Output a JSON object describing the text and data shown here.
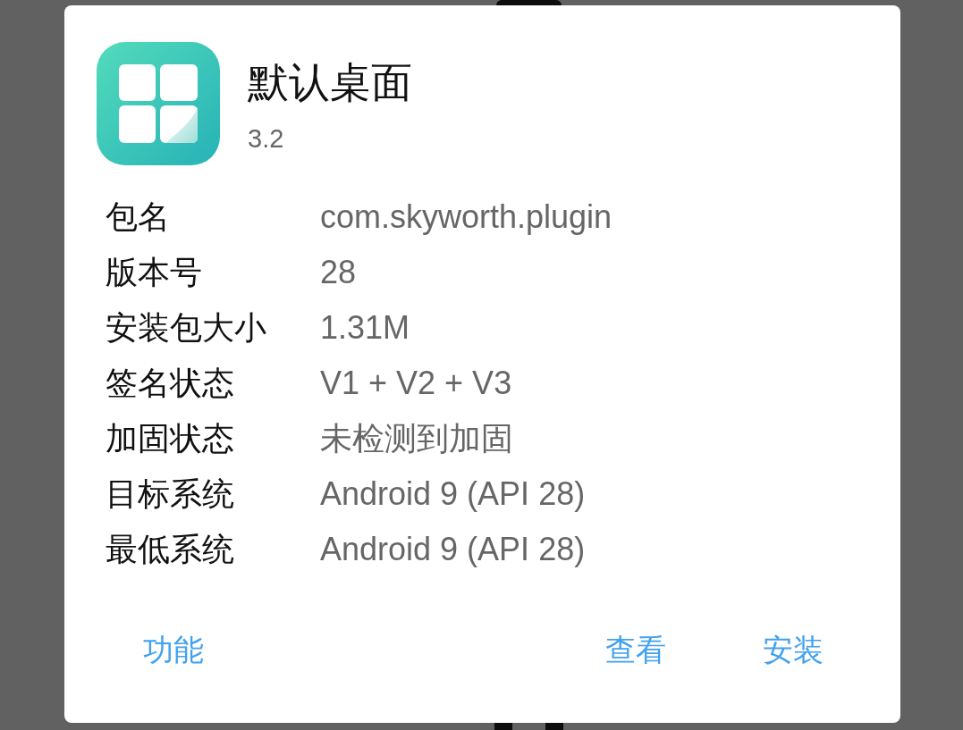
{
  "app": {
    "name": "默认桌面",
    "version": "3.2"
  },
  "details": [
    {
      "label": "包名",
      "value": "com.skyworth.plugin"
    },
    {
      "label": "版本号",
      "value": "28"
    },
    {
      "label": "安装包大小",
      "value": "1.31M"
    },
    {
      "label": "签名状态",
      "value": "V1 + V2 + V3"
    },
    {
      "label": "加固状态",
      "value": "未检测到加固"
    },
    {
      "label": "目标系统",
      "value": "Android 9 (API 28)"
    },
    {
      "label": "最低系统",
      "value": "Android 9 (API 28)"
    }
  ],
  "buttons": [
    {
      "label": "功能",
      "kind": "neutral"
    },
    {
      "label": "查看",
      "kind": "negative"
    },
    {
      "label": "安装",
      "kind": "positive"
    }
  ]
}
